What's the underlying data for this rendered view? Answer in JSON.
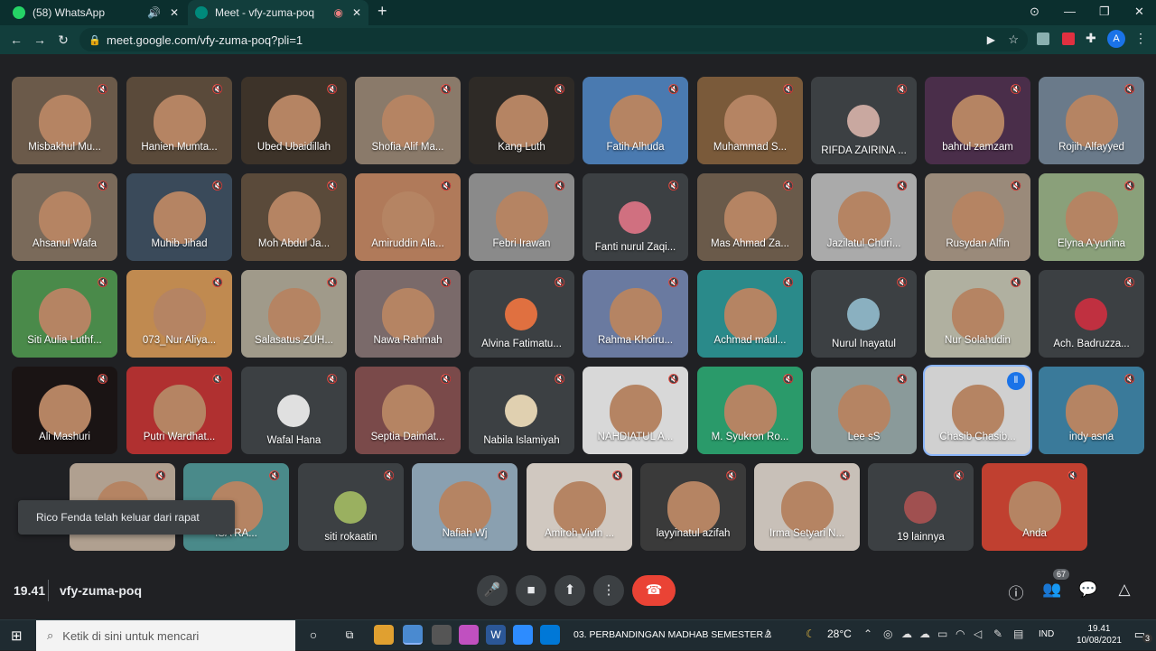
{
  "browser": {
    "tabs": [
      {
        "label": "(58) WhatsApp",
        "extra": "🔊",
        "color": "#25d366"
      },
      {
        "label": "Meet - vfy-zuma-poq",
        "extra": "◉",
        "color": "#00897b"
      }
    ],
    "new_tab": "+",
    "url": "meet.google.com/vfy-zuma-poq?pli=1",
    "profile_initial": "A",
    "window_controls": [
      "—",
      "❐",
      "✕"
    ]
  },
  "participants": [
    {
      "name": "Misbakhul Mu...",
      "color": "#6b5a4a"
    },
    {
      "name": "Hanien Mumta...",
      "color": "#5a4a3a"
    },
    {
      "name": "Ubed Ubaidillah",
      "color": "#3d3329"
    },
    {
      "name": "Shofia Alif Ma...",
      "color": "#8a7a6a"
    },
    {
      "name": "Kang Luth",
      "color": "#2e2a26"
    },
    {
      "name": "Fatih Alhuda",
      "color": "#4a7ab0"
    },
    {
      "name": "Muhammad S...",
      "color": "#7a5a3a"
    },
    {
      "name": "RIFDA ZAIRINA ...",
      "color": "#3c4043",
      "avatar": "#c9a8a0"
    },
    {
      "name": "bahrul zamzam",
      "color": "#4a2e4a"
    },
    {
      "name": "Rojih Alfayyed",
      "color": "#6a7a8a"
    },
    {
      "name": "Ahsanul Wafa",
      "color": "#7a6a5a"
    },
    {
      "name": "Muhib Jihad",
      "color": "#3a4a5a"
    },
    {
      "name": "Moh Abdul Ja...",
      "color": "#5a4a3a"
    },
    {
      "name": "Amiruddin Ala...",
      "color": "#b07a5a"
    },
    {
      "name": "Febri Irawan",
      "color": "#8a8a8a"
    },
    {
      "name": "Fanti nurul Zaqi...",
      "color": "#3c4043",
      "avatar": "#d07080"
    },
    {
      "name": "Mas Ahmad Za...",
      "color": "#6a5a4a"
    },
    {
      "name": "Jazilatul Churi...",
      "color": "#aaaaaa"
    },
    {
      "name": "Rusydan Alfin",
      "color": "#9a8a7a"
    },
    {
      "name": "Elyna A'yunina",
      "color": "#8aa07a"
    },
    {
      "name": "Siti Aulia Luthf...",
      "color": "#4a8a4a"
    },
    {
      "name": "073_Nur Aliya...",
      "color": "#c08a50"
    },
    {
      "name": "Salasatus ZUH...",
      "color": "#a09a8a"
    },
    {
      "name": "Nawa Rahmah",
      "color": "#7a6a6a"
    },
    {
      "name": "Alvina Fatimatu...",
      "color": "#3c4043",
      "avatar": "#e07040"
    },
    {
      "name": "Rahma Khoiru...",
      "color": "#6a7aa0"
    },
    {
      "name": "Achmad maul...",
      "color": "#2a8a8a"
    },
    {
      "name": "Nurul Inayatul",
      "color": "#3c4043",
      "avatar": "#8ab0c0"
    },
    {
      "name": "Nur Solahudin",
      "color": "#b0b0a0"
    },
    {
      "name": "Ach. Badruzza...",
      "color": "#3c4043",
      "avatar": "#c03040"
    },
    {
      "name": "Ali Mashuri",
      "color": "#1a1414"
    },
    {
      "name": "Putri Wardhat...",
      "color": "#b03030"
    },
    {
      "name": "Wafal Hana",
      "color": "#3c4043",
      "avatar": "#e0e0e0"
    },
    {
      "name": "Septia Daimat...",
      "color": "#7a4a4a"
    },
    {
      "name": "Nabila Islamiyah",
      "color": "#3c4043",
      "avatar": "#e0d0b0"
    },
    {
      "name": "NAHDIATUL A...",
      "color": "#d8d8d8"
    },
    {
      "name": "M. Syukron Ro...",
      "color": "#2a9a6a"
    },
    {
      "name": "Lee sS",
      "color": "#8a9a9a"
    },
    {
      "name": "Chasib Chasib...",
      "color": "#d0d0d0"
    },
    {
      "name": "indy asna",
      "color": "#3a7a9a"
    },
    {
      "name": "",
      "color": "#b0a090"
    },
    {
      "name": "ISA RA...",
      "color": "#4a8a8a"
    },
    {
      "name": "siti rokaatin",
      "color": "#3c4043",
      "avatar": "#9ab060"
    },
    {
      "name": "Nafiah Wj",
      "color": "#8aa0b0"
    },
    {
      "name": "Amiroh Vivin ...",
      "color": "#d0c8c0"
    },
    {
      "name": "layyinatul azifah",
      "color": "#3a3a3a"
    },
    {
      "name": "Irma Setyari N...",
      "color": "#c8c0b8"
    },
    {
      "name": "19 lainnya",
      "color": "#3c4043",
      "avatar": "#a05050"
    },
    {
      "name": "Anda",
      "color": "#c04030"
    }
  ],
  "toast": "Rico Fenda telah keluar dari rapat",
  "meeting": {
    "time": "19.41",
    "code": "vfy-zuma-poq",
    "people_count": "67"
  },
  "icons": {
    "mic": "🎤",
    "cam": "■",
    "present": "⬆",
    "more": "⋮",
    "end": "☎",
    "info": "ⓘ",
    "people": "👥",
    "chat": "💬",
    "activities": "△"
  },
  "taskbar": {
    "search_placeholder": "Ketik di sini untuk mencari",
    "active_app_label": "03. PERBANDINGAN MADHAB SEMESTER 2",
    "weather": "28°C",
    "lang": "IND",
    "clock_time": "19.41",
    "clock_date": "10/08/2021",
    "notif_count": "3"
  }
}
